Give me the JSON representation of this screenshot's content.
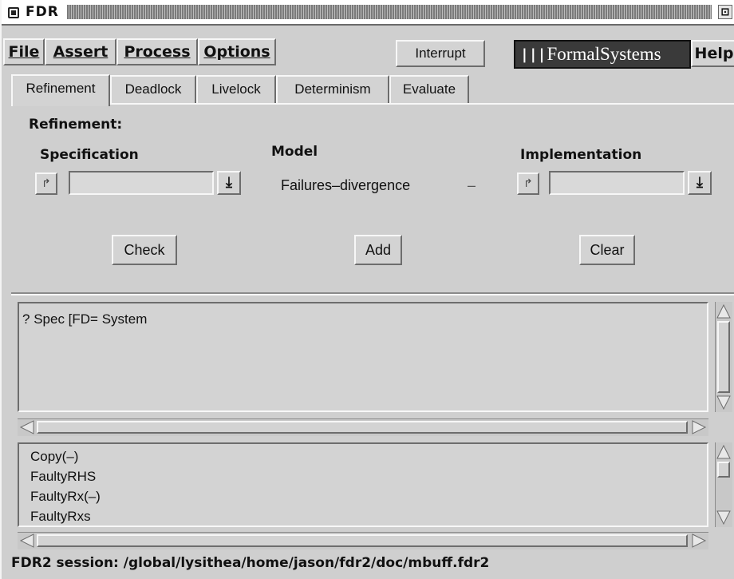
{
  "window": {
    "title": "FDR"
  },
  "menu": {
    "file": "File",
    "assert": "Assert",
    "process": "Process",
    "options": "Options",
    "help": "Help"
  },
  "toolbar": {
    "interrupt_label": "Interrupt"
  },
  "logo": {
    "bars": "|||",
    "text": "FormalSystems"
  },
  "tabs": [
    {
      "label": "Refinement",
      "active": true
    },
    {
      "label": "Deadlock",
      "active": false
    },
    {
      "label": "Livelock",
      "active": false
    },
    {
      "label": "Determinism",
      "active": false
    },
    {
      "label": "Evaluate",
      "active": false
    }
  ],
  "refinement": {
    "heading": "Refinement:",
    "specification_label": "Specification",
    "model_label": "Model",
    "implementation_label": "Implementation",
    "model_value": "Failures–divergence",
    "model_separator": "–",
    "specification_value": "",
    "implementation_value": "",
    "check_label": "Check",
    "add_label": "Add",
    "clear_label": "Clear"
  },
  "assertions": [
    {
      "status": "?",
      "text": "Spec [FD= System"
    }
  ],
  "processes": [
    "Copy(–)",
    "FaultyRHS",
    "FaultyRx(–)",
    "FaultyRxs"
  ],
  "status_bar": {
    "text": "FDR2 session: /global/lysithea/home/jason/fdr2/doc/mbuff.fdr2"
  },
  "icons": {
    "window_menu": "window-menu-icon",
    "maximize": "maximize-icon",
    "browse": "redo-arrow-icon",
    "dropdown": "download-arrow-icon"
  },
  "colors": {
    "window_bg": "#cfcfcf",
    "logo_bg": "#3a3a3a"
  }
}
